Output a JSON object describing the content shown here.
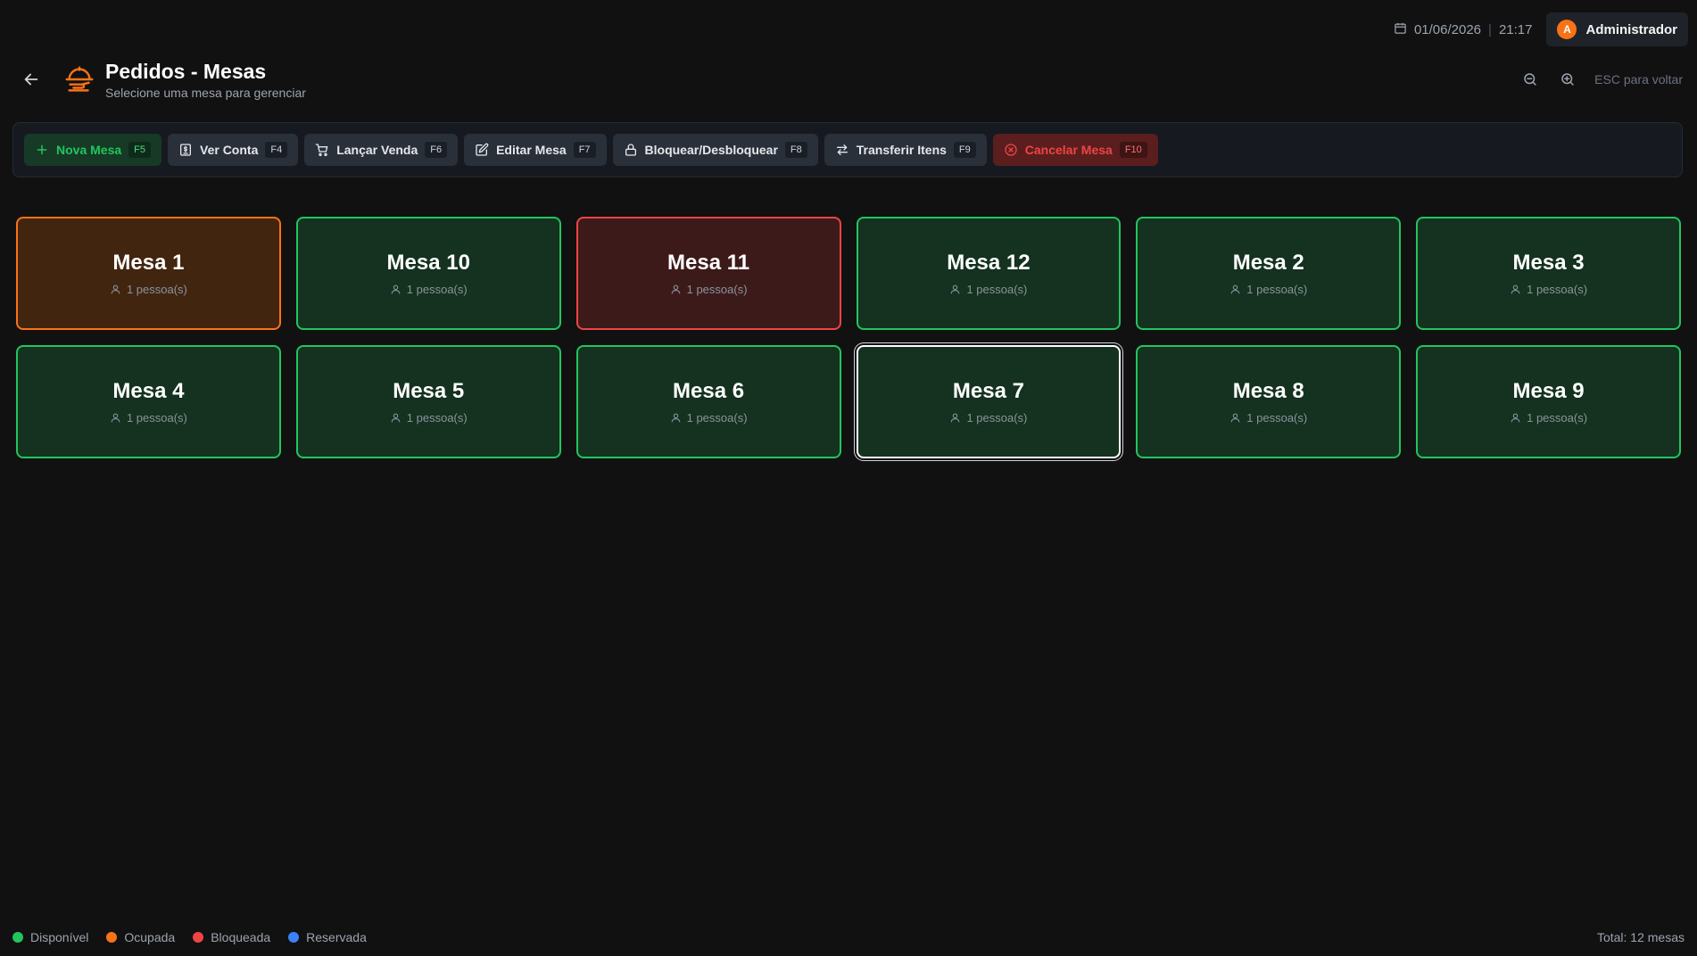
{
  "topbar": {
    "date": "01/06/2026",
    "separator": "|",
    "time": "21:17",
    "user_initial": "A",
    "user_name": "Administrador"
  },
  "header": {
    "title": "Pedidos - Mesas",
    "subtitle": "Selecione uma mesa para gerenciar",
    "esc_hint": "ESC para voltar"
  },
  "toolbar": {
    "buttons": [
      {
        "label": "Nova Mesa",
        "key": "F5",
        "icon": "plus-icon"
      },
      {
        "label": "Ver Conta",
        "key": "F4",
        "icon": "receipt-icon"
      },
      {
        "label": "Lançar Venda",
        "key": "F6",
        "icon": "cart-icon"
      },
      {
        "label": "Editar Mesa",
        "key": "F7",
        "icon": "edit-icon"
      },
      {
        "label": "Bloquear/Desbloquear",
        "key": "F8",
        "icon": "lock-icon"
      },
      {
        "label": "Transferir Itens",
        "key": "F9",
        "icon": "transfer-icon"
      },
      {
        "label": "Cancelar Mesa",
        "key": "F10",
        "icon": "cancel-circle-icon"
      }
    ]
  },
  "mesas": [
    {
      "name": "Mesa 1",
      "people": "1 pessoa(s)",
      "status": "ocupada"
    },
    {
      "name": "Mesa 10",
      "people": "1 pessoa(s)",
      "status": "disponivel"
    },
    {
      "name": "Mesa 11",
      "people": "1 pessoa(s)",
      "status": "bloqueada"
    },
    {
      "name": "Mesa 12",
      "people": "1 pessoa(s)",
      "status": "disponivel"
    },
    {
      "name": "Mesa 2",
      "people": "1 pessoa(s)",
      "status": "disponivel"
    },
    {
      "name": "Mesa 3",
      "people": "1 pessoa(s)",
      "status": "disponivel"
    },
    {
      "name": "Mesa 4",
      "people": "1 pessoa(s)",
      "status": "disponivel"
    },
    {
      "name": "Mesa 5",
      "people": "1 pessoa(s)",
      "status": "disponivel"
    },
    {
      "name": "Mesa 6",
      "people": "1 pessoa(s)",
      "status": "disponivel"
    },
    {
      "name": "Mesa 7",
      "people": "1 pessoa(s)",
      "status": "disponivel",
      "selected": true
    },
    {
      "name": "Mesa 8",
      "people": "1 pessoa(s)",
      "status": "disponivel"
    },
    {
      "name": "Mesa 9",
      "people": "1 pessoa(s)",
      "status": "disponivel"
    }
  ],
  "legend": [
    {
      "label": "Disponível",
      "color": "#22c55e"
    },
    {
      "label": "Ocupada",
      "color": "#f97316"
    },
    {
      "label": "Bloqueada",
      "color": "#ef4444"
    },
    {
      "label": "Reservada",
      "color": "#3b82f6"
    }
  ],
  "footer": {
    "total": "Total: 12 mesas"
  }
}
